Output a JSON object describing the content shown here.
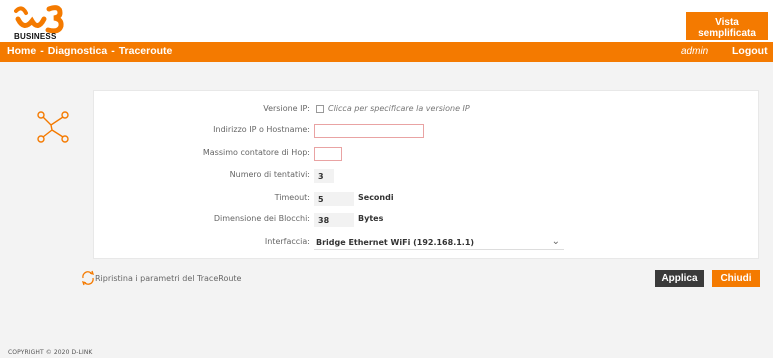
{
  "brand": {
    "logo_text": "BUSINESS"
  },
  "header": {
    "view_button": "Vista semplificata"
  },
  "nav": {
    "breadcrumb": [
      "Home",
      "Diagnostica",
      "Traceroute"
    ],
    "separator": "-",
    "user": "admin",
    "logout": "Logout"
  },
  "form": {
    "ip_version": {
      "label": "Versione IP:",
      "checkbox_label": "Clicca per specificare la versione IP"
    },
    "host": {
      "label": "Indirizzo IP o Hostname:",
      "value": ""
    },
    "max_hops": {
      "label": "Massimo contatore di Hop:",
      "value": ""
    },
    "tries": {
      "label": "Numero di tentativi:",
      "value": "3"
    },
    "timeout": {
      "label": "Timeout:",
      "value": "5",
      "unit": "Secondi"
    },
    "block_size": {
      "label": "Dimensione dei Blocchi:",
      "value": "38",
      "unit": "Bytes"
    },
    "interface": {
      "label": "Interfaccia:",
      "selected": "Bridge Ethernet WiFi (192.168.1.1)"
    }
  },
  "actions": {
    "reset": "Ripristina i parametri del TraceRoute",
    "apply": "Applica",
    "close": "Chiudi"
  },
  "footer": {
    "copyright": "COPYRIGHT © 2020 D-LINK"
  },
  "colors": {
    "accent": "#f47a00",
    "dark_button": "#3a3a3a"
  },
  "icons": {
    "tool": "traceroute-network-icon",
    "reset": "refresh-icon",
    "dropdown": "chevron-down-icon"
  }
}
